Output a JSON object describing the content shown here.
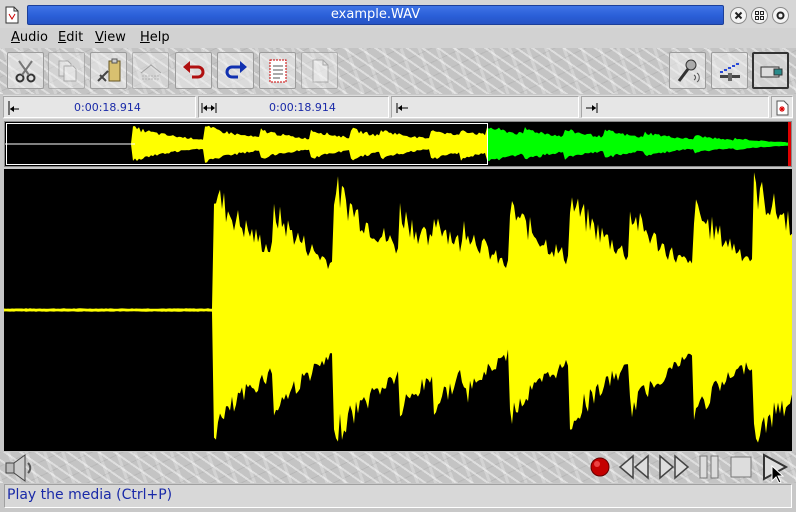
{
  "window": {
    "title": "example.WAV"
  },
  "menu": {
    "items": [
      "Audio",
      "Edit",
      "View",
      "Help"
    ]
  },
  "selection": {
    "start": "0:00:18.914",
    "length": "0:00:18.914"
  },
  "status": {
    "text": "Play the media  (Ctrl+P)"
  },
  "toolbar": {
    "left_icons": [
      "scissors-icon",
      "copy-icon",
      "paste-icon",
      "paste-mix-icon",
      "undo-icon",
      "redo-icon",
      "clipboard-icon",
      "document-icon"
    ],
    "right_icons": [
      "microphone-icon",
      "levels-icon",
      "connection-icon"
    ]
  },
  "transport": {
    "icons": [
      "speaker-icon",
      "record-icon",
      "rewind-icon",
      "fast-forward-icon",
      "pause-icon",
      "stop-icon",
      "play-icon"
    ]
  },
  "colors": {
    "title_bar": "#2a5fd8",
    "wave_played": "#ffff00",
    "wave_remaining": "#00ff00",
    "wave_background": "#000000",
    "status_text": "#1a2aa8",
    "playhead": "#ff0000"
  }
}
